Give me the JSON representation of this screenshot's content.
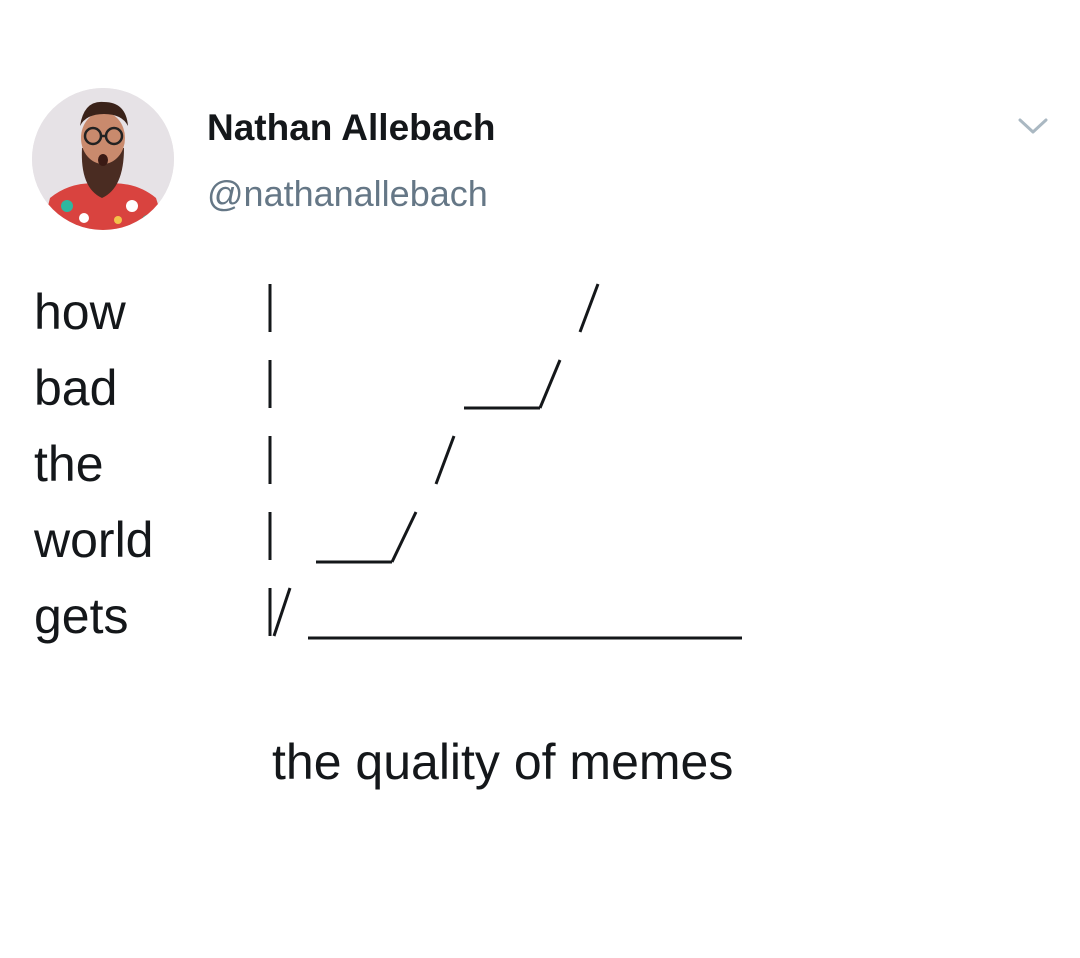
{
  "tweet": {
    "author": {
      "display_name": "Nathan Allebach",
      "handle": "@nathanallebach",
      "avatar_icon": "profile-photo"
    },
    "menu_icon": "chevron-down-icon",
    "lines": [
      "how",
      "bad",
      "the",
      "world",
      "gets"
    ],
    "caption": "the quality of memes"
  }
}
